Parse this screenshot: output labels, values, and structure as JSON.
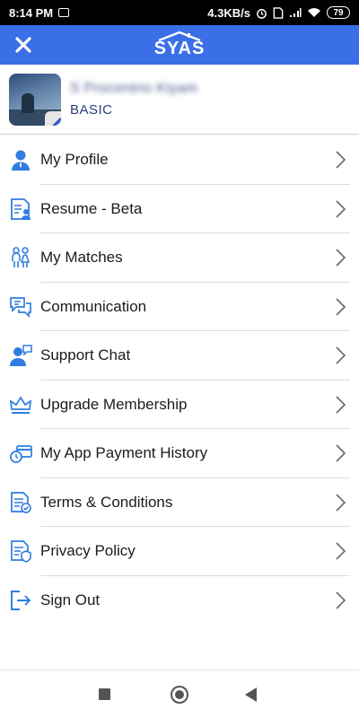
{
  "status_bar": {
    "time": "8:14 PM",
    "network_speed": "4.3KB/s",
    "battery": "79"
  },
  "header": {
    "logo_text": "SYAS"
  },
  "profile": {
    "name": "S Procentrio Kiyam",
    "membership": "BASIC"
  },
  "menu": {
    "items": [
      {
        "label": "My Profile",
        "icon": "user-icon"
      },
      {
        "label": "Resume - Beta",
        "icon": "resume-icon"
      },
      {
        "label": "My Matches",
        "icon": "couple-icon"
      },
      {
        "label": "Communication",
        "icon": "chat-bubbles-icon"
      },
      {
        "label": "Support Chat",
        "icon": "support-icon"
      },
      {
        "label": "Upgrade Membership",
        "icon": "crown-icon"
      },
      {
        "label": "My App Payment History",
        "icon": "payment-history-icon"
      },
      {
        "label": "Terms & Conditions",
        "icon": "terms-document-icon"
      },
      {
        "label": "Privacy Policy",
        "icon": "privacy-document-icon"
      },
      {
        "label": "Sign Out",
        "icon": "sign-out-icon"
      }
    ]
  },
  "colors": {
    "header_bg": "#3b6fe8",
    "icon_blue": "#2f7de1",
    "membership_text": "#2a3f7a"
  }
}
